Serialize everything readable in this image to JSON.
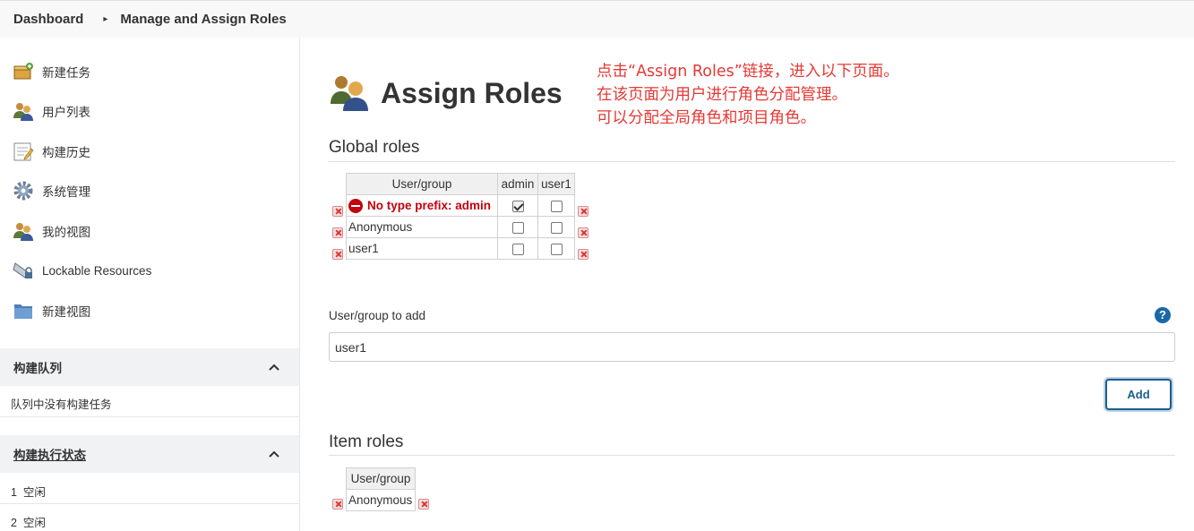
{
  "breadcrumb": {
    "items": [
      "Dashboard",
      "Manage and Assign Roles"
    ],
    "separator": "▸"
  },
  "sidebar": {
    "tasks": [
      {
        "label": "新建任务",
        "icon": "new-job-icon"
      },
      {
        "label": "用户列表",
        "icon": "people-icon"
      },
      {
        "label": "构建历史",
        "icon": "notepad-icon"
      },
      {
        "label": "系统管理",
        "icon": "gear-icon"
      },
      {
        "label": "我的视图",
        "icon": "user-icon"
      },
      {
        "label": "Lockable Resources",
        "icon": "lock-resource-icon"
      },
      {
        "label": "新建视图",
        "icon": "folder-icon"
      }
    ],
    "build_queue": {
      "title": "构建队列",
      "empty_text": "队列中没有构建任务"
    },
    "executors": {
      "title": "构建执行状态",
      "rows": [
        {
          "num": "1",
          "status": "空闲"
        },
        {
          "num": "2",
          "status": "空闲"
        }
      ]
    }
  },
  "main": {
    "title": "Assign Roles",
    "annotation": [
      "点击“Assign Roles”链接，进入以下页面。",
      "在该页面为用户进行角色分配管理。",
      "可以分配全局角色和项目角色。"
    ],
    "global_roles": {
      "title": "Global roles",
      "header": "User/group",
      "roles": [
        "admin",
        "user1"
      ],
      "rows": [
        {
          "name": "No type prefix: admin",
          "error": true,
          "checks": [
            true,
            false
          ]
        },
        {
          "name": "Anonymous",
          "error": false,
          "checks": [
            false,
            false
          ]
        },
        {
          "name": "user1",
          "error": false,
          "checks": [
            false,
            false
          ]
        }
      ]
    },
    "add_user": {
      "label": "User/group to add",
      "value": "user1",
      "button": "Add",
      "help": "?"
    },
    "item_roles": {
      "title": "Item roles",
      "header": "User/group",
      "rows": [
        "Anonymous"
      ]
    }
  },
  "colors": {
    "annotation": "#e53935",
    "error": "#c4000a",
    "accent": "#1a5e8d"
  }
}
